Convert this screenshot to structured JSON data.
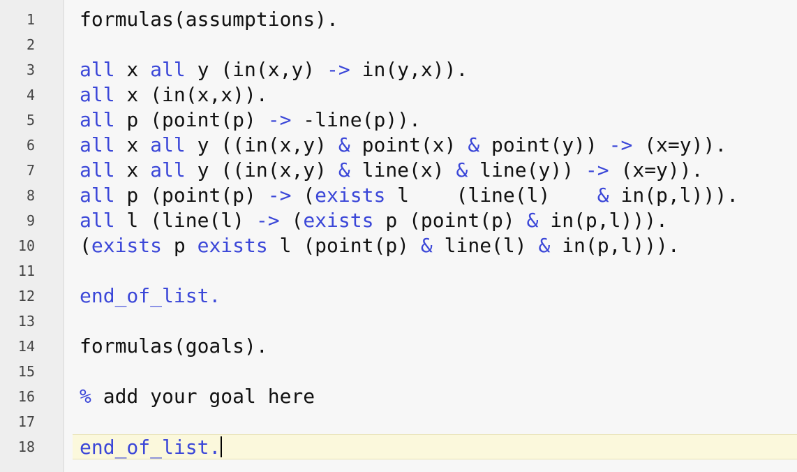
{
  "editor": {
    "line_numbers": [
      "1",
      "2",
      "3",
      "4",
      "5",
      "6",
      "7",
      "8",
      "9",
      "10",
      "11",
      "12",
      "13",
      "14",
      "15",
      "16",
      "17",
      "18"
    ],
    "lines": [
      [
        {
          "t": "formulas(assumptions)."
        }
      ],
      [],
      [
        {
          "k": "all"
        },
        {
          "t": " x "
        },
        {
          "k": "all"
        },
        {
          "t": " y (in(x,y) "
        },
        {
          "k": "->"
        },
        {
          "t": " in(y,x))."
        }
      ],
      [
        {
          "k": "all"
        },
        {
          "t": " x (in(x,x))."
        }
      ],
      [
        {
          "k": "all"
        },
        {
          "t": " p (point(p) "
        },
        {
          "k": "->"
        },
        {
          "t": " -line(p))."
        }
      ],
      [
        {
          "k": "all"
        },
        {
          "t": " x "
        },
        {
          "k": "all"
        },
        {
          "t": " y ((in(x,y) "
        },
        {
          "k": "&"
        },
        {
          "t": " point(x) "
        },
        {
          "k": "&"
        },
        {
          "t": " point(y)) "
        },
        {
          "k": "->"
        },
        {
          "t": " (x=y))."
        }
      ],
      [
        {
          "k": "all"
        },
        {
          "t": " x "
        },
        {
          "k": "all"
        },
        {
          "t": " y ((in(x,y) "
        },
        {
          "k": "&"
        },
        {
          "t": " line(x) "
        },
        {
          "k": "&"
        },
        {
          "t": " line(y)) "
        },
        {
          "k": "->"
        },
        {
          "t": " (x=y))."
        }
      ],
      [
        {
          "k": "all"
        },
        {
          "t": " p (point(p) "
        },
        {
          "k": "->"
        },
        {
          "t": " ("
        },
        {
          "k": "exists"
        },
        {
          "t": " l    (line(l)    "
        },
        {
          "k": "&"
        },
        {
          "t": " in(p,l)))."
        }
      ],
      [
        {
          "k": "all"
        },
        {
          "t": " l (line(l) "
        },
        {
          "k": "->"
        },
        {
          "t": " ("
        },
        {
          "k": "exists"
        },
        {
          "t": " p (point(p) "
        },
        {
          "k": "&"
        },
        {
          "t": " in(p,l)))."
        }
      ],
      [
        {
          "t": "("
        },
        {
          "k": "exists"
        },
        {
          "t": " p "
        },
        {
          "k": "exists"
        },
        {
          "t": " l (point(p) "
        },
        {
          "k": "&"
        },
        {
          "t": " line(l) "
        },
        {
          "k": "&"
        },
        {
          "t": " in(p,l)))."
        }
      ],
      [],
      [
        {
          "k": "end_of_list."
        }
      ],
      [],
      [
        {
          "t": "formulas(goals)."
        }
      ],
      [],
      [
        {
          "k": "%"
        },
        {
          "t": " add your goal here"
        }
      ],
      [],
      [
        {
          "k": "end_of_list."
        }
      ]
    ],
    "active_line": 18,
    "colors": {
      "keyword": "#3b47d8",
      "text": "#111111",
      "gutter_bg": "#eeeeee",
      "active_line_bg": "#fbf8dc"
    }
  }
}
